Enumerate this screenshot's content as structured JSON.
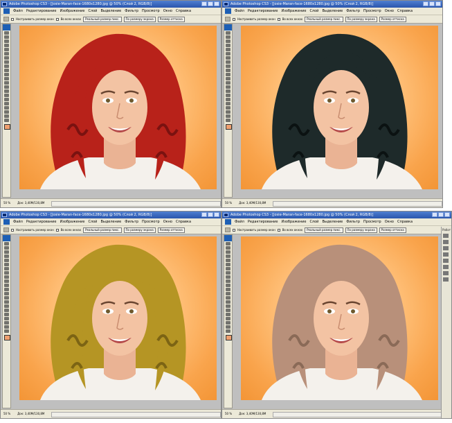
{
  "window": {
    "title": "Adobe Photoshop CS3 - [Josie-Maran-face-1680x1280.jpg @ 50% (Слой 2, RGB/8)]"
  },
  "menu": [
    "Файл",
    "Редактирование",
    "Изображение",
    "Слой",
    "Выделение",
    "Фильтр",
    "Просмотр",
    "Окно",
    "Справка"
  ],
  "options": {
    "resize_windows": "Настраивать размер окон",
    "all_windows": "Во всех окнах",
    "actual_pixels": "Реальный размер пикс.",
    "fit_screen": "По размеру экрана",
    "print_size": "Размер оттиска"
  },
  "status": {
    "zoom": "50 %",
    "doc_size": "Док: 3,40M/130,8M"
  },
  "partial_panel_label": "Работ",
  "panels": [
    {
      "id": "red",
      "hair_color": "#b8221a",
      "hair_shade": "#7a1210"
    },
    {
      "id": "black",
      "hair_color": "#1e2a2a",
      "hair_shade": "#0b1212"
    },
    {
      "id": "golden",
      "hair_color": "#b59524",
      "hair_shade": "#7c6414"
    },
    {
      "id": "ash-blonde",
      "hair_color": "#b8907a",
      "hair_shade": "#8a6a57"
    }
  ]
}
